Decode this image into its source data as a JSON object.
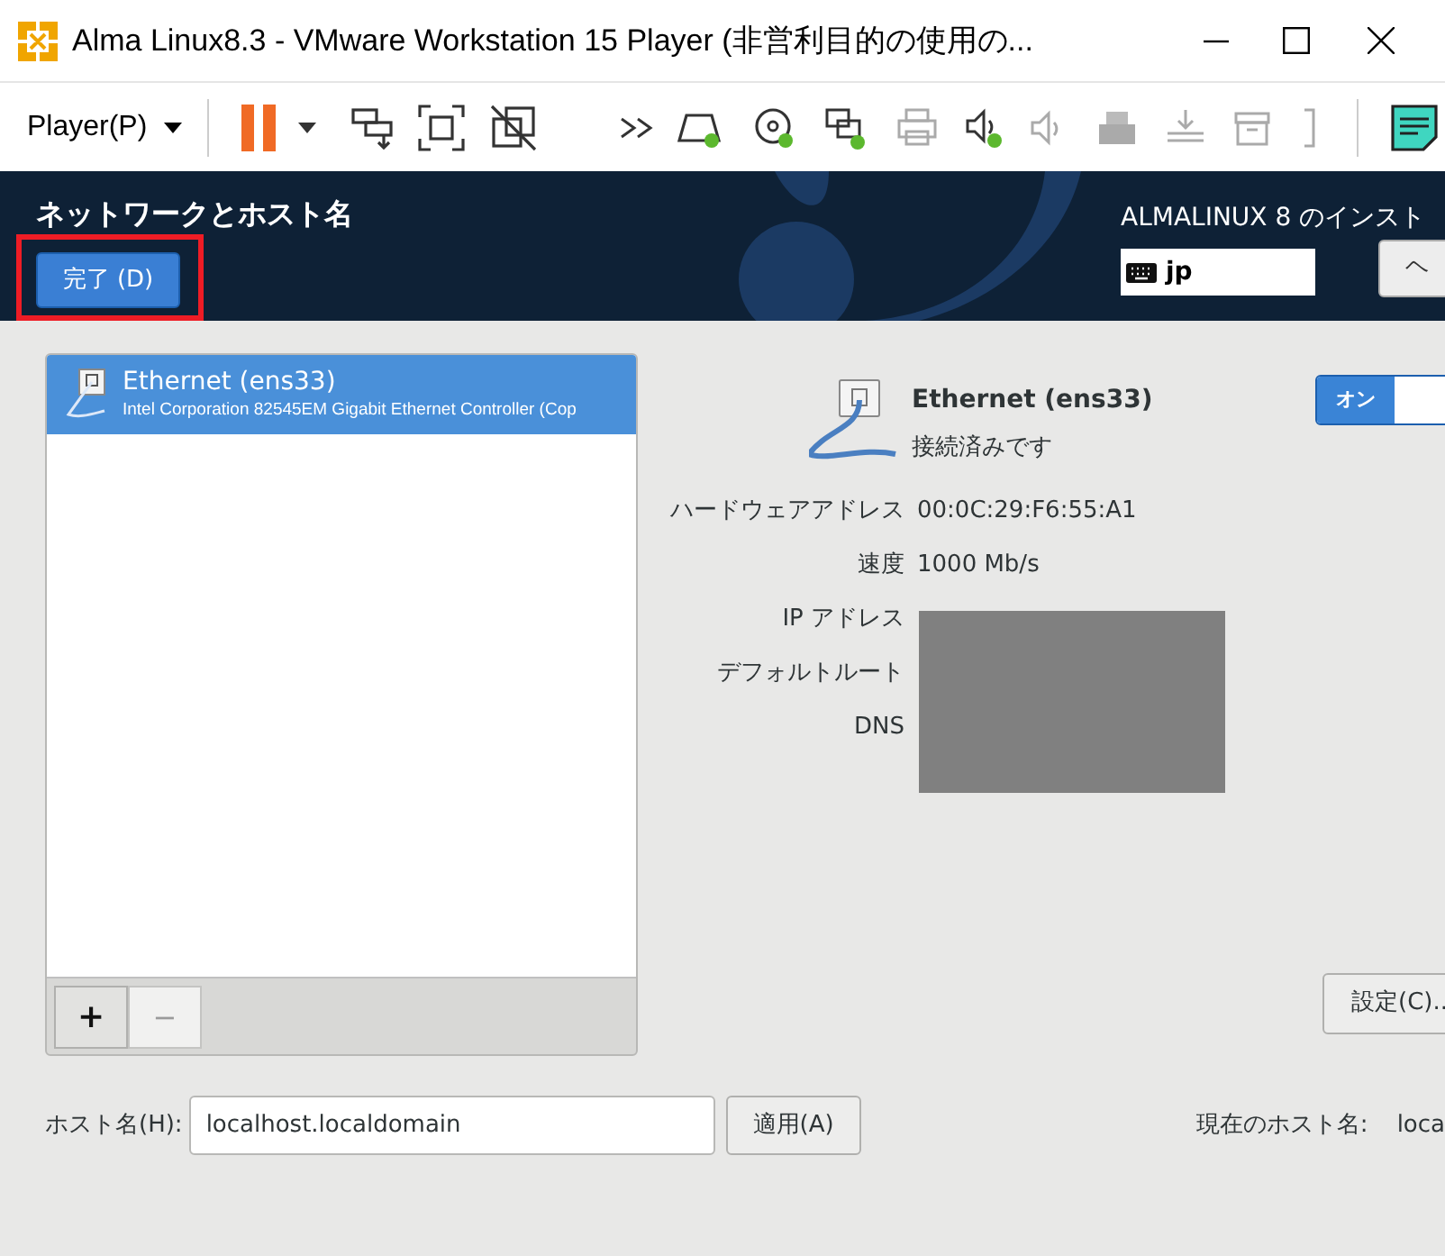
{
  "window": {
    "title": "Alma Linux8.3 - VMware Workstation 15 Player (非営利目的の使用の..."
  },
  "toolbar": {
    "menu": "Player(P)"
  },
  "header": {
    "title": "ネットワークとホスト名",
    "done_button": "完了 (D)",
    "product": "ALMALINUX 8 のインスト",
    "keyboard_layout": "jp",
    "help_button": "ヘ"
  },
  "devices": [
    {
      "name": "Ethernet (ens33)",
      "description": "Intel Corporation 82545EM Gigabit Ethernet Controller (Cop",
      "selected": true
    }
  ],
  "list_buttons": [
    {
      "label": "+",
      "disabled": false
    },
    {
      "label": "−",
      "disabled": true
    }
  ],
  "detail": {
    "name": "Ethernet (ens33)",
    "status": "接続済みです",
    "switch": {
      "label": "オン",
      "on": true
    },
    "fields": [
      {
        "label": "ハードウェアアドレス",
        "value": "00:0C:29:F6:55:A1"
      },
      {
        "label": "速度",
        "value": "1000 Mb/s"
      },
      {
        "label": "IP アドレス"
      },
      {
        "label": "デフォルトルート"
      },
      {
        "label": "DNS"
      }
    ],
    "configure_button": "設定(C).."
  },
  "hostname": {
    "label": "ホスト名(H):",
    "value": "localhost.localdomain",
    "apply_button": "適用(A)",
    "current_label": "現在のホスト名:",
    "current_value": "loca"
  }
}
